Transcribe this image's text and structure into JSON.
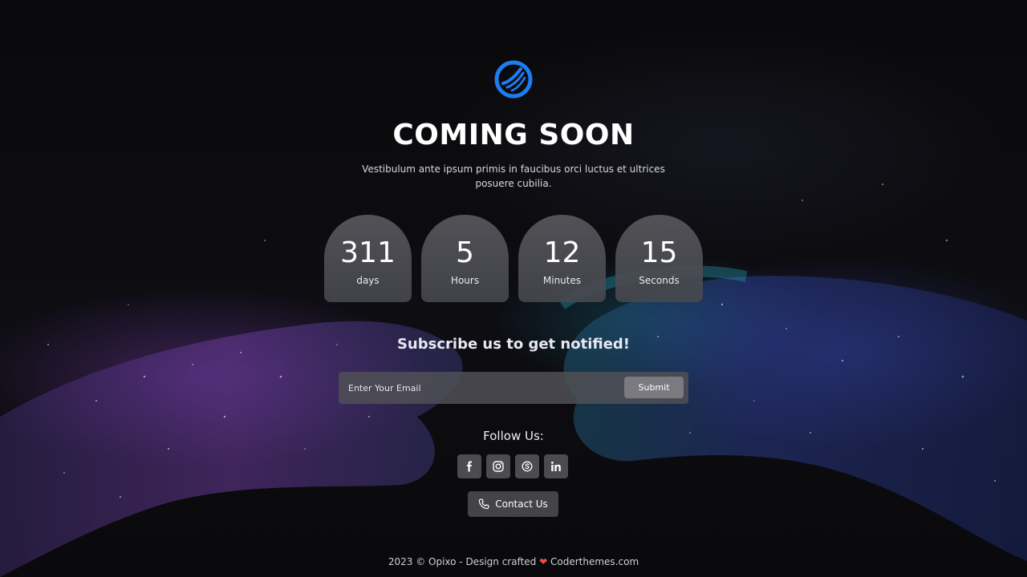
{
  "brand": {
    "logo_icon": "opixo-logo-icon",
    "accent_color": "#1e7cf2"
  },
  "hero": {
    "title": "COMING SOON",
    "subtitle": "Vestibulum ante ipsum primis in faucibus orci luctus et ultrices posuere cubilia."
  },
  "countdown": [
    {
      "value": "311",
      "label": "days"
    },
    {
      "value": "5",
      "label": "Hours"
    },
    {
      "value": "12",
      "label": "Minutes"
    },
    {
      "value": "15",
      "label": "Seconds"
    }
  ],
  "subscribe": {
    "title": "Subscribe us to get notified!",
    "placeholder": "Enter Your Email",
    "value": "",
    "button_label": "Submit"
  },
  "follow": {
    "title": "Follow Us:",
    "icons": [
      "facebook-icon",
      "instagram-icon",
      "skype-icon",
      "linkedin-icon"
    ]
  },
  "contact": {
    "label": "Contact Us",
    "icon": "phone-icon"
  },
  "footer": {
    "prefix": "2023 © Opixo - Design crafted",
    "heart": "❤",
    "link": "Coderthemes.com",
    "heart_color": "#f04b4b"
  }
}
